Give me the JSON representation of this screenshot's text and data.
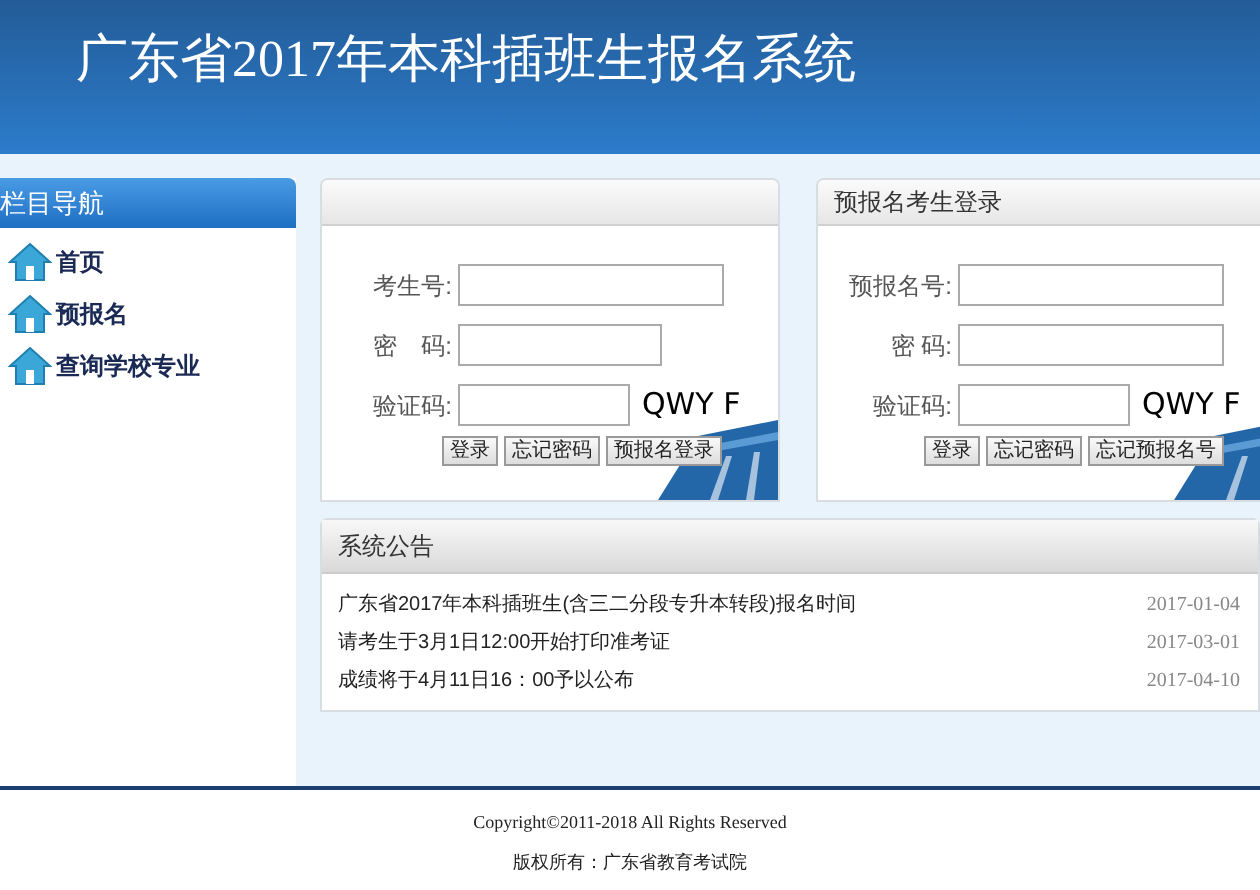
{
  "header": {
    "title": "广东省2017年本科插班生报名系统"
  },
  "sidebar": {
    "title": "栏目导航",
    "items": [
      {
        "label": "首页"
      },
      {
        "label": "预报名"
      },
      {
        "label": "查询学校专业"
      }
    ]
  },
  "login_panels": [
    {
      "fields": [
        {
          "label": "考生号:",
          "kind": "text"
        },
        {
          "label": "密　码:",
          "kind": "password"
        },
        {
          "label": "验证码:",
          "kind": "captcha",
          "captcha": "QWY F"
        }
      ],
      "buttons": [
        "登录",
        "忘记密码",
        "预报名登录"
      ]
    },
    {
      "title": "预报名考生登录",
      "fields": [
        {
          "label": "预报名号:",
          "kind": "text"
        },
        {
          "label": "密 码:",
          "kind": "password"
        },
        {
          "label": "验证码:",
          "kind": "captcha",
          "captcha": "QWY F"
        }
      ],
      "buttons": [
        "登录",
        "忘记密码",
        "忘记预报名号"
      ]
    }
  ],
  "notices": {
    "title": "系统公告",
    "items": [
      {
        "text": "广东省2017年本科插班生(含三二分段专升本转段)报名时间",
        "date": "2017-01-04"
      },
      {
        "text": "请考生于3月1日12:00开始打印准考证",
        "date": "2017-03-01"
      },
      {
        "text": "成绩将于4月11日16：00予以公布",
        "date": "2017-04-10"
      }
    ]
  },
  "footer": {
    "lines": [
      "Copyright©2011-2018 All Rights Reserved",
      "版权所有：广东省教育考试院"
    ]
  }
}
